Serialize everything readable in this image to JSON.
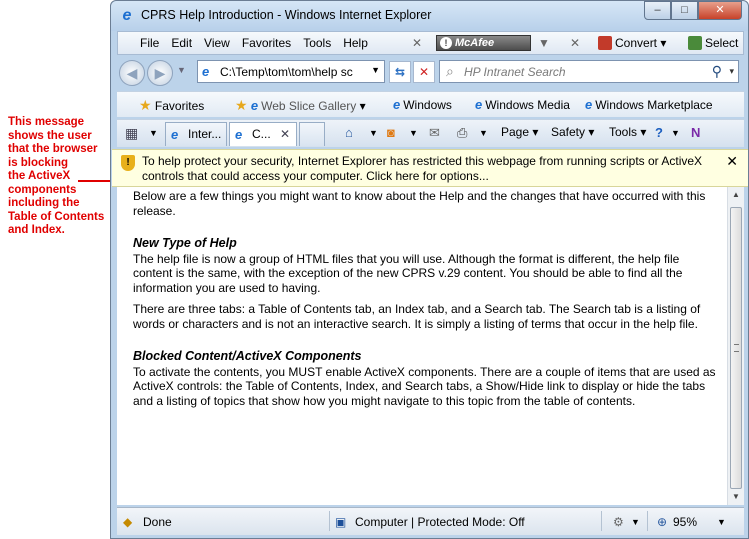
{
  "annotation": {
    "lines": [
      "This message",
      "shows the user",
      "that the browser",
      "is blocking",
      "the ActiveX",
      "components",
      "including the",
      "Table of Contents",
      "and Index."
    ]
  },
  "window": {
    "title": "CPRS Help Introduction - Windows Internet Explorer",
    "controls": {
      "minimize": "–",
      "maximize": "□",
      "close": "✕"
    }
  },
  "menu": {
    "items": [
      "File",
      "Edit",
      "View",
      "Favorites",
      "Tools",
      "Help"
    ],
    "mcafee": "McAfee",
    "convert": "Convert",
    "select": "Select"
  },
  "address": {
    "url": "C:\\Temp\\tom\\tom\\help sc",
    "search_placeholder": "HP Intranet Search"
  },
  "favorites": {
    "label": "Favorites",
    "links": [
      "Web Slice Gallery",
      "Windows",
      "Windows Media",
      "Windows Marketplace"
    ]
  },
  "tabs": [
    {
      "label": "Inter..."
    },
    {
      "label": "C..."
    }
  ],
  "commands": {
    "page": "Page",
    "safety": "Safety",
    "tools": "Tools"
  },
  "infobar": {
    "message": "To help protect your security, Internet Explorer has restricted this webpage from running scripts or ActiveX controls that could access your computer. Click here for options...",
    "close": "✕"
  },
  "content": {
    "intro": "Below are a few things you might want to know about the Help and the changes that have occurred with this release.",
    "sections": [
      {
        "heading": "New Type of Help",
        "paragraphs": [
          "The help file is now a group of HTML files that you will use. Although the format is different, the help file content is the same, with the exception of the new CPRS v.29 content. You should be able to find all the information you are used to having.",
          "There are three tabs: a Table of Contents tab, an Index tab, and a Search tab. The Search tab is a listing of words or characters and is not an interactive search. It is simply a listing of terms that occur in the help file."
        ]
      },
      {
        "heading": "Blocked Content/ActiveX Components",
        "paragraphs": [
          "To activate the contents, you MUST enable ActiveX components. There are a couple of items that are used as ActiveX controls: the Table of Contents, Index, and Search tabs, a Show/Hide link to display or hide the tabs and a listing of topics that show how you might navigate to this topic from the table of contents."
        ]
      }
    ]
  },
  "status": {
    "text": "Done",
    "zone": "Computer | Protected Mode: Off",
    "zoom": "95%"
  },
  "colors": {
    "annotation": "#e00000",
    "infobar_bg": "#ffffe1",
    "chrome": "#bcd3ea"
  }
}
